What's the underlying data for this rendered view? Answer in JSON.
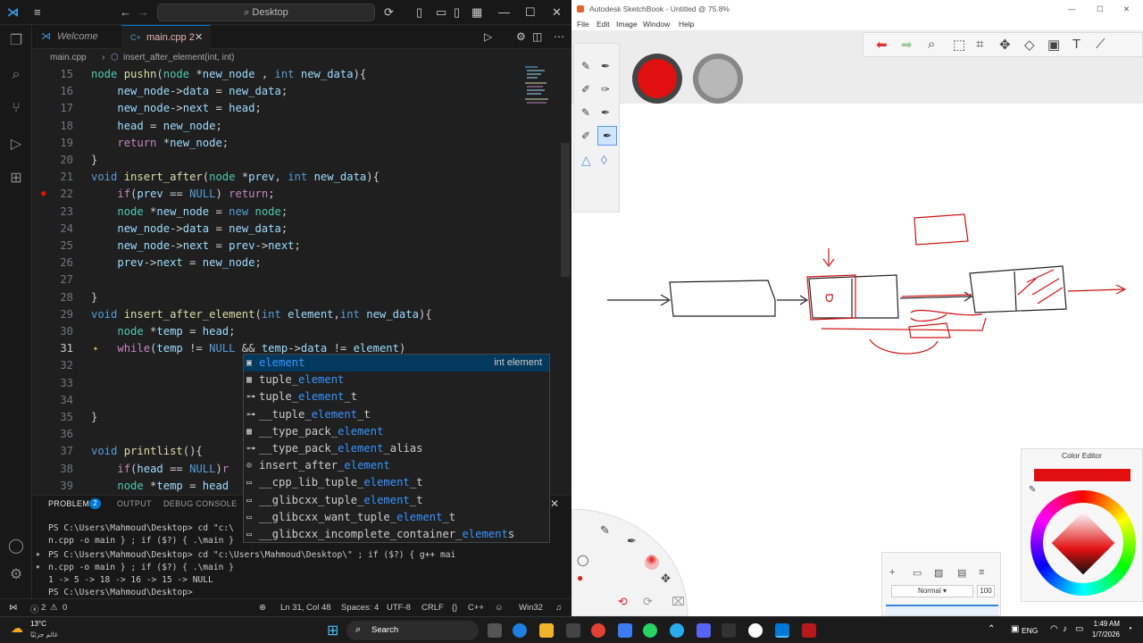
{
  "vscode": {
    "search_label": "Desktop",
    "tabs": [
      {
        "label": "Welcome"
      },
      {
        "label": "main.cpp",
        "badge": "2"
      }
    ],
    "breadcrumb": {
      "file": "main.cpp",
      "symbol": "insert_after_element(int, int)"
    },
    "code_lines": [
      {
        "n": "15",
        "html": "<span class='ty'>node</span> <span class='fn'>pushn</span>(<span class='ty'>node</span> *<span class='pa'>new_node</span> , <span class='kw'>int</span> <span class='pa'>new_data</span>){"
      },
      {
        "n": "16",
        "html": "    <span class='pa'>new_node</span>-><span class='pa'>data</span> = <span class='pa'>new_data</span>;"
      },
      {
        "n": "17",
        "html": "    <span class='pa'>new_node</span>-><span class='pa'>next</span> = <span class='pa'>head</span>;"
      },
      {
        "n": "18",
        "html": "    <span class='pa'>head</span> = <span class='pa'>new_node</span>;"
      },
      {
        "n": "19",
        "html": "    <span class='ct'>return</span> *<span class='pa'>new_node</span>;"
      },
      {
        "n": "20",
        "html": "}"
      },
      {
        "n": "21",
        "html": "<span class='kw'>void</span> <span class='fn'>insert_after</span>(<span class='ty'>node</span> *<span class='pa'>prev</span>, <span class='kw'>int</span> <span class='pa'>new_data</span>){"
      },
      {
        "n": "22",
        "html": "    <span class='ct'>if</span>(<span class='pa'>prev</span> == <span class='kw'>NULL</span>) <span class='ct'>return</span>;"
      },
      {
        "n": "23",
        "html": "    <span class='ty'>node</span> *<span class='pa'>new_node</span> = <span class='kw'>new</span> <span class='ty'>node</span>;"
      },
      {
        "n": "24",
        "html": "    <span class='pa'>new_node</span>-><span class='pa'>data</span> = <span class='pa'>new_data</span>;"
      },
      {
        "n": "25",
        "html": "    <span class='pa'>new_node</span>-><span class='pa'>next</span> = <span class='pa'>prev</span>-><span class='pa'>next</span>;"
      },
      {
        "n": "26",
        "html": "    <span class='pa'>prev</span>-><span class='pa'>next</span> = <span class='pa'>new_node</span>;"
      },
      {
        "n": "27",
        "html": ""
      },
      {
        "n": "28",
        "html": "}"
      },
      {
        "n": "29",
        "html": "<span class='kw'>void</span> <span class='fn'>insert_after_element</span>(<span class='kw'>int</span> <span class='pa'>element</span>,<span class='kw'>int</span> <span class='pa'>new_data</span>){"
      },
      {
        "n": "30",
        "html": "    <span class='ty'>node</span> *<span class='pa'>temp</span> = <span class='pa'>head</span>;"
      },
      {
        "n": "31",
        "html": "    <span class='ct'>while</span>(<span class='pa'>temp</span> != <span class='kw'>NULL</span> && <span class='pa'>temp</span>-><span class='pa'>data</span> != <span class='pa'>element</span>)"
      },
      {
        "n": "32",
        "html": ""
      },
      {
        "n": "33",
        "html": ""
      },
      {
        "n": "34",
        "html": ""
      },
      {
        "n": "35",
        "html": "}"
      },
      {
        "n": "36",
        "html": ""
      },
      {
        "n": "37",
        "html": "<span class='kw'>void</span> <span class='fn'>printlist</span>(){"
      },
      {
        "n": "38",
        "html": "    <span class='ct'>if</span>(<span class='pa'>head</span> == <span class='kw'>NULL</span>)<span class='ct'>r</span>"
      },
      {
        "n": "39",
        "html": "    <span class='ty'>node</span> *<span class='pa'>temp</span> = <span class='pa'>head</span>"
      }
    ],
    "suggestions": [
      {
        "icon": "▣",
        "pre": "",
        "hl": "element",
        "post": "",
        "detail": "int element"
      },
      {
        "icon": "▦",
        "pre": "tuple_",
        "hl": "element",
        "post": "",
        "detail": ""
      },
      {
        "icon": "⊶",
        "pre": "tuple_",
        "hl": "element",
        "post": "_t",
        "detail": ""
      },
      {
        "icon": "⊶",
        "pre": "__tuple_",
        "hl": "element",
        "post": "_t",
        "detail": ""
      },
      {
        "icon": "▦",
        "pre": "__type_pack_",
        "hl": "element",
        "post": "",
        "detail": ""
      },
      {
        "icon": "⊶",
        "pre": "__type_pack_",
        "hl": "element",
        "post": "_alias",
        "detail": ""
      },
      {
        "icon": "⊙",
        "pre": "insert_after_",
        "hl": "element",
        "post": "",
        "detail": ""
      },
      {
        "icon": "▭",
        "pre": "__cpp_lib_tuple_",
        "hl": "element",
        "post": "_t",
        "detail": ""
      },
      {
        "icon": "▭",
        "pre": "__glibcxx_tuple_",
        "hl": "element",
        "post": "_t",
        "detail": ""
      },
      {
        "icon": "▭",
        "pre": "__glibcxx_want_tuple_",
        "hl": "element",
        "post": "_t",
        "detail": ""
      },
      {
        "icon": "▭",
        "pre": "__glibcxx_incomplete_container_",
        "hl": "element",
        "post": "s",
        "detail": ""
      }
    ],
    "panel": {
      "tabs": [
        "PROBLEMS",
        "OUTPUT",
        "DEBUG CONSOLE"
      ],
      "problems_count": "2",
      "terminal": [
        "PS C:\\Users\\Mahmoud\\Desktop> cd \"c:\\",
        "n.cpp -o main } ; if ($?) { .\\main }",
        "PS C:\\Users\\Mahmoud\\Desktop> cd \"c:\\Users\\Mahmoud\\Desktop\\\" ; if ($?) { g++ mai",
        "n.cpp -o main } ; if ($?) { .\\main }",
        "1 -> 5 -> 18 -> 16 -> 15 -> NULL",
        "PS C:\\Users\\Mahmoud\\Desktop> "
      ]
    },
    "status": {
      "errors": "2",
      "warnings": "0",
      "position": "Ln 31, Col 48",
      "spaces": "Spaces: 4",
      "encoding": "UTF-8",
      "eol": "CRLF",
      "language": "C++",
      "platform": "Win32"
    }
  },
  "sketchbook": {
    "title": "Autodesk SketchBook - Untitled @ 75.8%",
    "menu": [
      "File",
      "Edit",
      "Image",
      "Window",
      "Help"
    ],
    "brush_color": "#e01010",
    "color_editor_title": "Color Editor",
    "layer_blend": "Normal",
    "layer_opacity": "100"
  },
  "taskbar": {
    "weather_temp": "13°C",
    "weather_desc": "غائم جزئيًا",
    "search_label": "Search",
    "lang": "ENG",
    "time": "1:49 AM",
    "date": "1/7/2026"
  }
}
